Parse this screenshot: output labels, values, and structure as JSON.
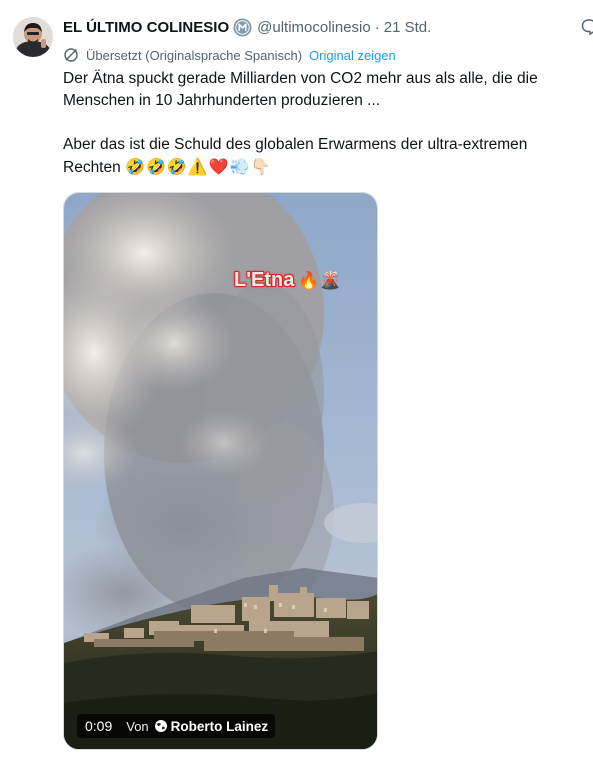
{
  "author": {
    "name": "EL ÚLTIMO COLINESIO",
    "handle": "@ultimocolinesio",
    "separator": "·",
    "timestamp": "21 Std."
  },
  "translation": {
    "notice": "Übersetzt (Originalsprache Spanisch)",
    "show_original": "Original zeigen"
  },
  "tweet": {
    "line1": "Der Ätna spuckt gerade Milliarden von CO2 mehr aus als alle, die die Menschen in 10 Jahrhunderten produzieren ...",
    "line2": "Aber das ist die Schuld des globalen Erwarmens der ultra-extremen Rechten",
    "emojis": [
      "🤣",
      "🤣",
      "🤣",
      "⚠️",
      "❤️",
      "💨",
      "👇🏻"
    ]
  },
  "media": {
    "caption": "L'Etna",
    "caption_emojis": "🔥🌋",
    "duration": "0:09",
    "by_label": "Von",
    "video_author": "Roberto Lainez"
  },
  "icons": {
    "verified": "verified-badge-icon",
    "translate": "translate-icon",
    "more": "reply-icon",
    "globe": "globe-icon"
  },
  "colors": {
    "link": "#1d9bf0",
    "secondary_text": "#536471",
    "verified_badge": "#829aab"
  }
}
